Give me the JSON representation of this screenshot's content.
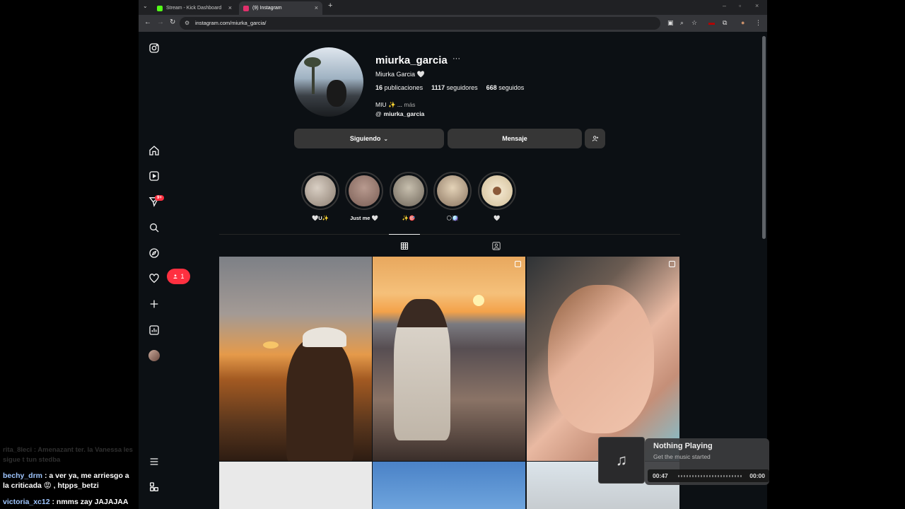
{
  "browser": {
    "tabs": [
      {
        "title": "Stream - Kick Dashboard",
        "favicon_color": "#53fc18"
      },
      {
        "title": "(9) Instagram",
        "favicon_color": "#e1306c",
        "active": true
      }
    ],
    "url": "instagram.com/miurka_garcia/"
  },
  "sidebar": {
    "items": [
      "instagram-logo-icon",
      "home-icon",
      "reels-icon",
      "messages-icon",
      "search-icon",
      "explore-icon",
      "notifications-icon",
      "create-icon",
      "dashboard-icon",
      "profile-avatar",
      "menu-icon",
      "threads-icon"
    ],
    "messages_badge": "9+",
    "likes_count": "1"
  },
  "profile": {
    "username": "miurka_garcia",
    "full_name": "Miurka Garcia 🤍",
    "posts_count": "16",
    "posts_label": "publicaciones",
    "followers_count": "1117",
    "followers_label": "seguidores",
    "following_count": "668",
    "following_label": "seguidos",
    "bio": "MIU ✨ ...",
    "bio_more": "más",
    "threads_handle": "miurka_garcia",
    "follow_button": "Siguiendo",
    "message_button": "Mensaje"
  },
  "highlights": [
    {
      "label": "🤍U✨",
      "color": "#a89a8c"
    },
    {
      "label": "Just me 🤍",
      "color": "#9a7f76"
    },
    {
      "label": "✨🎯",
      "color": "#8f8675"
    },
    {
      "label": "🌕🪩",
      "color": "#b8a48c"
    },
    {
      "label": "🤍",
      "color": "#d7c3a2"
    }
  ],
  "chat": {
    "faded_line": "rita_8leci : Amenazant ter. la Vanessa les sigue t tun stedba",
    "lines": [
      {
        "user": "bechy_drm",
        "text": "a ver ya, me arriesgo a la criticada 😡 , htpps_betzi"
      },
      {
        "user": "victoria_xc12",
        "text": "nmms zay JAJAJAA"
      }
    ]
  },
  "now_playing": {
    "title": "Nothing Playing",
    "subtitle": "Get the music started",
    "current_time": "00:47",
    "end_time": "00:00"
  }
}
